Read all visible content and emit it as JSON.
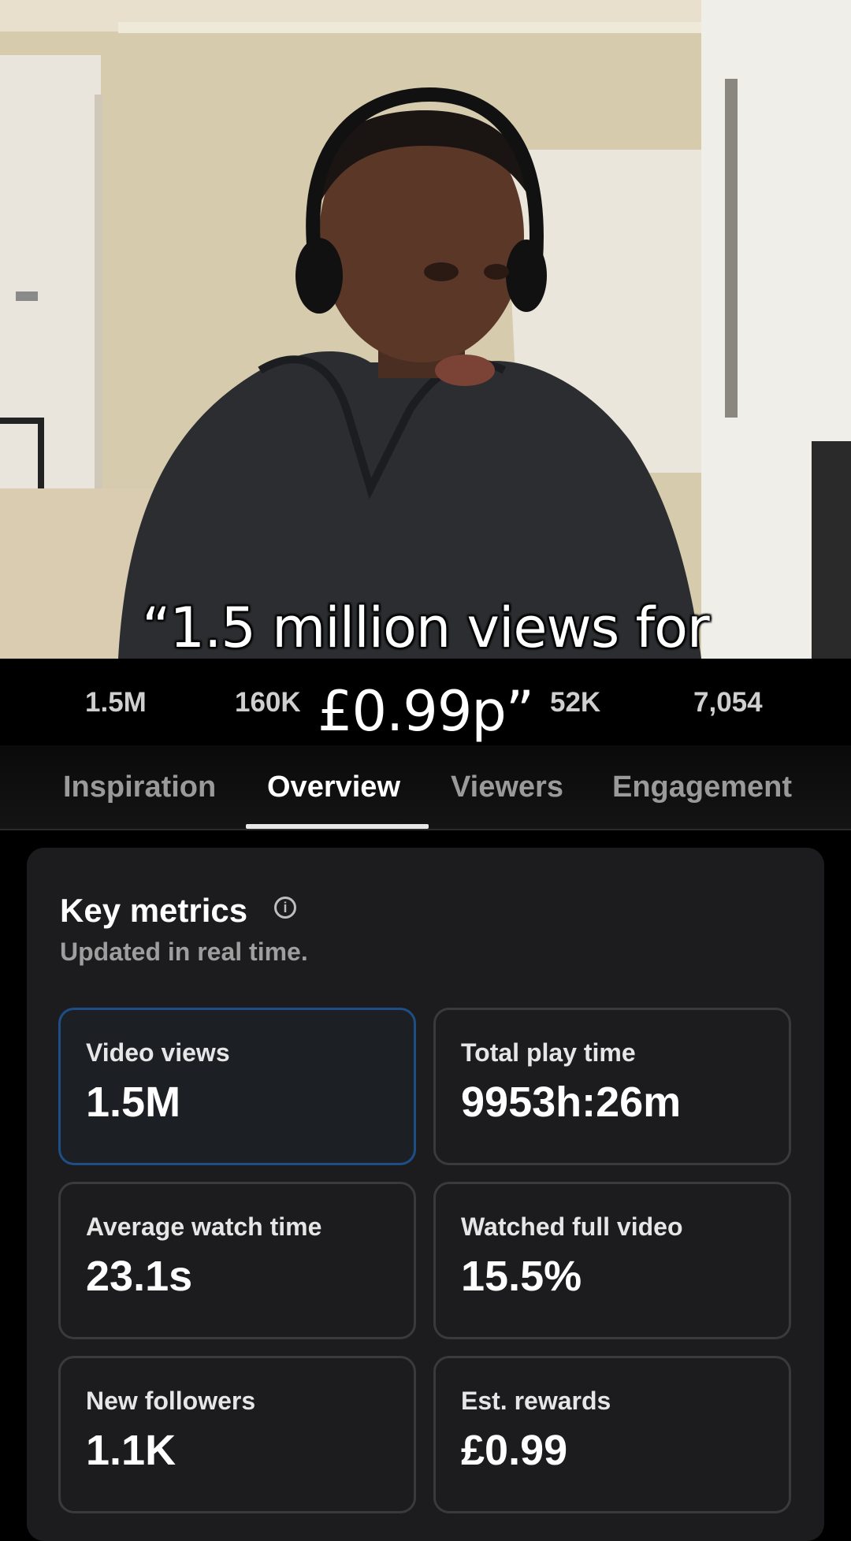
{
  "video": {
    "caption_line_1": "“1.5 million views for",
    "caption_line_2": "£0.99p”"
  },
  "stats_strip": {
    "views": "1.5M",
    "likes": "160K",
    "comments": "52K",
    "shares": "7,054"
  },
  "tabs": [
    {
      "label": "Inspiration",
      "active": false
    },
    {
      "label": "Overview",
      "active": true
    },
    {
      "label": "Viewers",
      "active": false
    },
    {
      "label": "Engagement",
      "active": false
    }
  ],
  "key_metrics": {
    "title": "Key metrics",
    "subtitle": "Updated in real time.",
    "info_icon_glyph": "i",
    "tiles": [
      {
        "label": "Video views",
        "value": "1.5M",
        "selected": true
      },
      {
        "label": "Total play time",
        "value": "9953h:26m",
        "selected": false
      },
      {
        "label": "Average watch time",
        "value": "23.1s",
        "selected": false
      },
      {
        "label": "Watched full video",
        "value": "15.5%",
        "selected": false
      },
      {
        "label": "New followers",
        "value": "1.1K",
        "selected": false
      },
      {
        "label": "Est. rewards",
        "value": "£0.99",
        "selected": false
      }
    ]
  },
  "colors": {
    "card_bg": "#1c1c1e",
    "selected_border": "#1d4f86",
    "tile_border": "#3a3a3c"
  }
}
